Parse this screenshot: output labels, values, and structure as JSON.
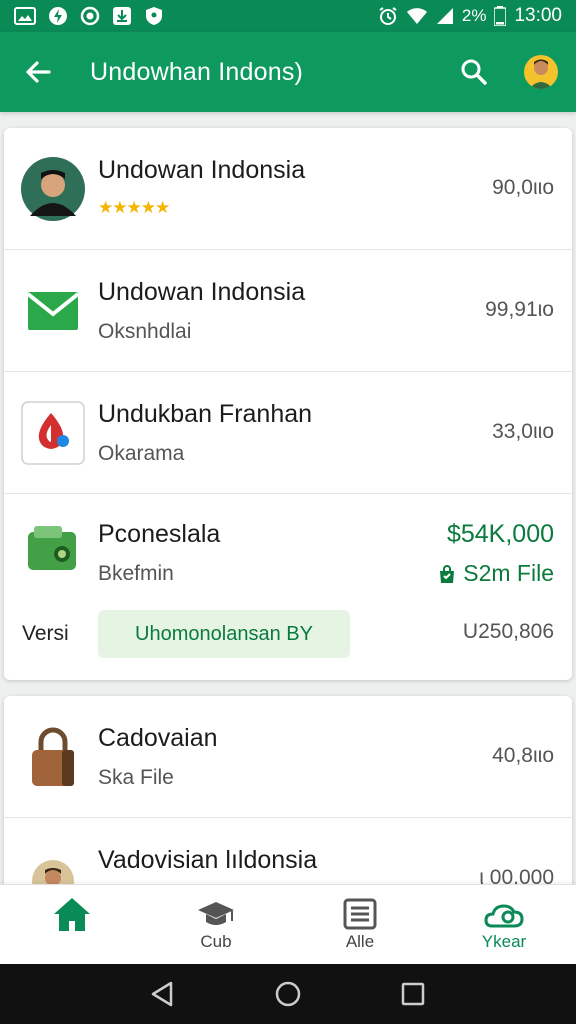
{
  "status": {
    "battery": "2%",
    "time": "13:00"
  },
  "appbar": {
    "title": "Undowhan Indons)"
  },
  "rows": [
    {
      "name": "Undowan Indonsia",
      "stars": "★★★★★",
      "price": "90,0ιιo"
    },
    {
      "name": "Undowan Indonsia",
      "sub": "Oksnhdlai",
      "price": "99,91ιo"
    },
    {
      "name": "Undukban Franhan",
      "sub": "Okarama",
      "price": "33,0ιιo"
    }
  ],
  "featured": {
    "name": "Pconeslala",
    "sub": "Bkefmin",
    "price": "$54K,000",
    "file_label": "S2m File",
    "versi_label": "Versi",
    "pill_text": "Uhomonolansan BY",
    "code": "U250,806"
  },
  "rows2": [
    {
      "name": "Cadovaian",
      "sub": "Ska File",
      "price": "40,8ιιo"
    },
    {
      "name": "Vadovisian lıldonsia",
      "price": "ι 00,000"
    }
  ],
  "bottom_nav": [
    {
      "label": "",
      "icon": "home-icon"
    },
    {
      "label": "Cub",
      "icon": "graduation-cap-icon"
    },
    {
      "label": "Alle",
      "icon": "list-icon"
    },
    {
      "label": "Ykear",
      "icon": "gear-cloud-icon"
    }
  ],
  "colors": {
    "primary": "#0e9a5f",
    "status_bar": "#0a8a55",
    "accent_green": "#0a7a3d",
    "star": "#f4b400"
  }
}
